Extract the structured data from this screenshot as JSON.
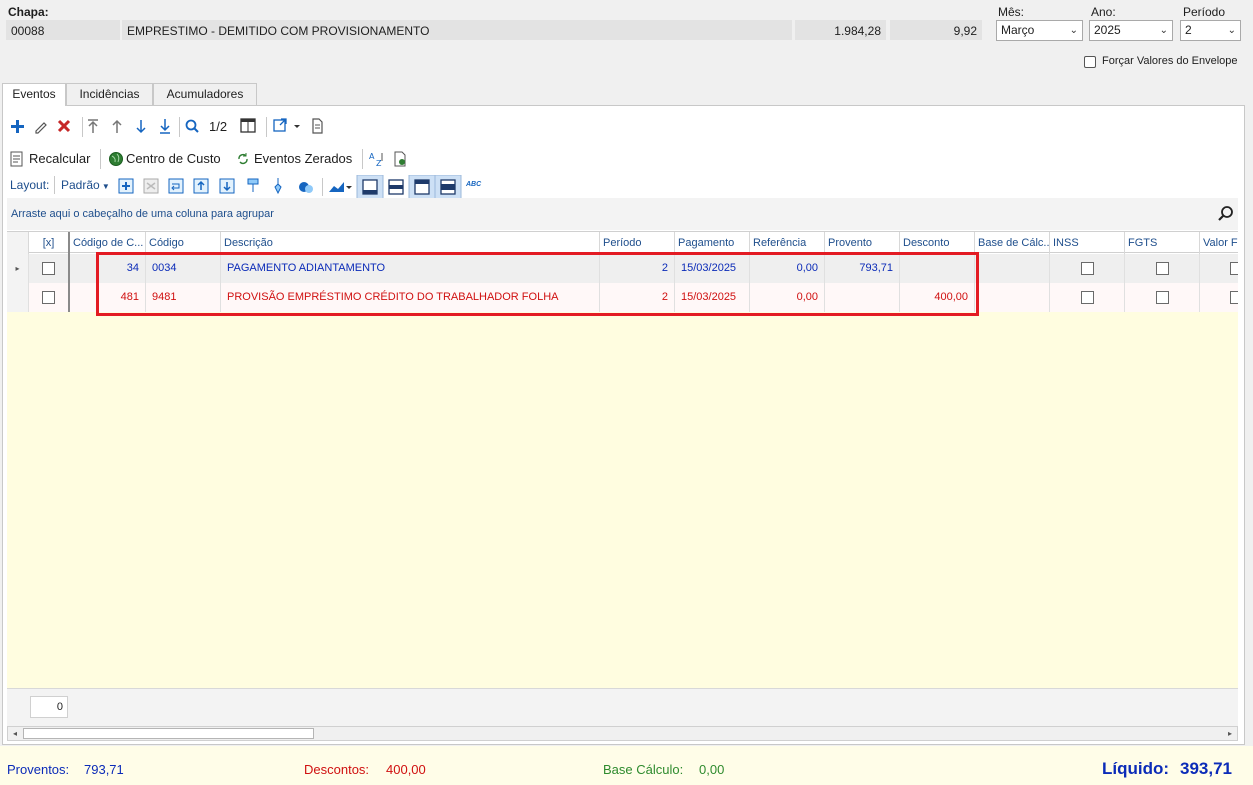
{
  "header": {
    "chapa_label": "Chapa:",
    "chapa_value": "00088",
    "description": "EMPRESTIMO - DEMITIDO COM PROVISIONAMENTO",
    "value1": "1.984,28",
    "value2": "9,92",
    "mes_label": "Mês:",
    "mes_value": "Março",
    "ano_label": "Ano:",
    "ano_value": "2025",
    "periodo_label": "Período",
    "periodo_value": "2",
    "forcar_label": "Forçar Valores do Envelope"
  },
  "tabs": [
    {
      "label": "Eventos"
    },
    {
      "label": "Incidências"
    },
    {
      "label": "Acumuladores"
    }
  ],
  "toolbar": {
    "pager": "1/2"
  },
  "actions": {
    "recalcular": "Recalcular",
    "centro_custo": "Centro de Custo",
    "eventos_zerados": "Eventos Zerados"
  },
  "layout_bar": {
    "label": "Layout:",
    "padrao": "Padrão",
    "abc": "ABC"
  },
  "group_hint": "Arraste aqui o cabeçalho de uma coluna para agrupar",
  "columns": [
    "[x]",
    "Código de C...",
    "Código",
    "Descrição",
    "Período",
    "Pagamento",
    "Referência",
    "Provento",
    "Desconto",
    "Base de Cálc...",
    "INSS",
    "FGTS",
    "Valor Fo"
  ],
  "rows": [
    {
      "codigo_c": "34",
      "codigo": "0034",
      "descricao": "PAGAMENTO ADIANTAMENTO",
      "periodo": "2",
      "pagamento": "15/03/2025",
      "referencia": "0,00",
      "provento": "793,71",
      "desconto": "",
      "base": ""
    },
    {
      "codigo_c": "481",
      "codigo": "9481",
      "descricao": "PROVISÃO EMPRÉSTIMO CRÉDITO DO TRABALHADOR FOLHA",
      "periodo": "2",
      "pagamento": "15/03/2025",
      "referencia": "0,00",
      "provento": "",
      "desconto": "400,00",
      "base": ""
    }
  ],
  "grid_footer_count": "0",
  "totals": {
    "proventos_label": "Proventos:",
    "proventos_value": "793,71",
    "descontos_label": "Descontos:",
    "descontos_value": "400,00",
    "base_label": "Base Cálculo:",
    "base_value": "0,00",
    "liquido_label": "Líquido:",
    "liquido_value": "393,71"
  },
  "colors": {
    "provento_blue": "#0b2bb8",
    "desconto_red": "#d01010",
    "base_green": "#2e8b2e",
    "highlight_red": "#e31b23",
    "grid_empty_bg": "#fffde0"
  }
}
